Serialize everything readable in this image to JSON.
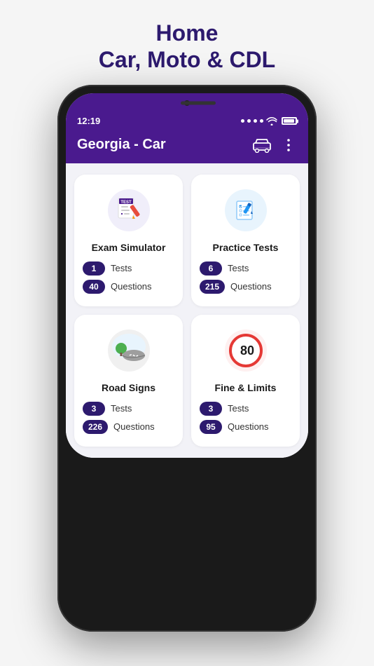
{
  "page": {
    "title_line1": "Home",
    "title_line2": "Car, Moto & CDL"
  },
  "status_bar": {
    "time": "12:19",
    "wifi": "wifi",
    "battery": "battery"
  },
  "app_header": {
    "title": "Georgia - Car"
  },
  "cards": [
    {
      "id": "exam-simulator",
      "title": "Exam Simulator",
      "icon": "exam",
      "stats": [
        {
          "value": "1",
          "label": "Tests"
        },
        {
          "value": "40",
          "label": "Questions"
        }
      ]
    },
    {
      "id": "practice-tests",
      "title": "Practice Tests",
      "icon": "practice",
      "stats": [
        {
          "value": "6",
          "label": "Tests"
        },
        {
          "value": "215",
          "label": "Questions"
        }
      ]
    },
    {
      "id": "road-signs",
      "title": "Road Signs",
      "icon": "road",
      "stats": [
        {
          "value": "3",
          "label": "Tests"
        },
        {
          "value": "226",
          "label": "Questions"
        }
      ]
    },
    {
      "id": "fine-limits",
      "title": "Fine & Limits",
      "icon": "speed",
      "stats": [
        {
          "value": "3",
          "label": "Tests"
        },
        {
          "value": "95",
          "label": "Questions"
        }
      ]
    }
  ]
}
